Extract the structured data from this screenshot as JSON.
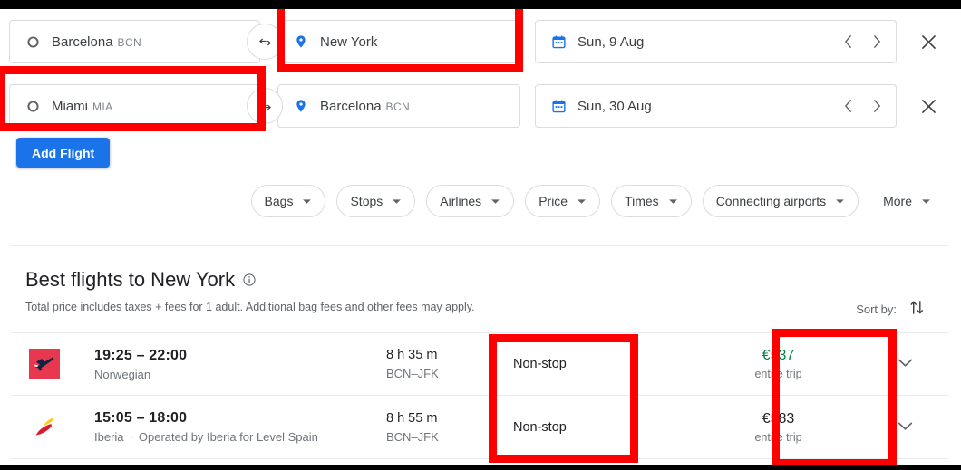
{
  "search": {
    "flights": [
      {
        "origin": {
          "city": "Barcelona",
          "code": "BCN",
          "icon": "circle-outline-icon"
        },
        "destination": {
          "city": "New York",
          "code": "",
          "icon": "location-pin-icon"
        },
        "date": "Sun, 9 Aug",
        "swap_icon": "swap-horizontal-icon",
        "calendar_icon": "calendar-icon",
        "prev_icon": "chevron-left-icon",
        "next_icon": "chevron-right-icon",
        "close_icon": "close-icon"
      },
      {
        "origin": {
          "city": "Miami",
          "code": "MIA",
          "icon": "circle-outline-icon"
        },
        "destination": {
          "city": "Barcelona",
          "code": "BCN",
          "icon": "location-pin-icon"
        },
        "date": "Sun, 30 Aug",
        "swap_icon": "swap-horizontal-icon",
        "calendar_icon": "calendar-icon",
        "prev_icon": "chevron-left-icon",
        "next_icon": "chevron-right-icon",
        "close_icon": "close-icon"
      }
    ],
    "add_flight_label": "Add Flight",
    "add_flight_color": "#1a73e8"
  },
  "filters": [
    {
      "label": "Bags",
      "caret": "chevron-down-icon"
    },
    {
      "label": "Stops",
      "caret": "chevron-down-icon"
    },
    {
      "label": "Airlines",
      "caret": "chevron-down-icon"
    },
    {
      "label": "Price",
      "caret": "chevron-down-icon"
    },
    {
      "label": "Times",
      "caret": "chevron-down-icon"
    },
    {
      "label": "Connecting airports",
      "caret": "chevron-down-icon"
    },
    {
      "label": "More",
      "caret": "chevron-down-icon"
    }
  ],
  "results": {
    "title": "Best flights to New York",
    "info_icon": "info-icon",
    "subtitle_before": "Total price includes taxes + fees for 1 adult. ",
    "subtitle_link": "Additional bag fees",
    "subtitle_after": " and other fees may apply.",
    "sort_label": "Sort by:",
    "sort_icon": "sort-arrows-icon",
    "flights": [
      {
        "airline_logo": "norwegian-logo",
        "times": "19:25 – 22:00",
        "airline": "Norwegian",
        "operator": "",
        "duration": "8 h 35 m",
        "route": "BCN–JFK",
        "stops": "Non-stop",
        "price": "€537",
        "price_note": "entire trip",
        "price_style": "cheap",
        "price_color": "#018642",
        "expand_icon": "chevron-down-icon"
      },
      {
        "airline_logo": "iberia-logo",
        "times": "15:05 – 18:00",
        "airline": "Iberia",
        "operator": "Operated by Iberia for Level Spain",
        "duration": "8 h 55 m",
        "route": "BCN–JFK",
        "stops": "Non-stop",
        "price": "€583",
        "price_note": "entire trip",
        "price_style": "normal",
        "price_color": "#202124",
        "expand_icon": "chevron-down-icon"
      }
    ]
  },
  "annotations": {
    "color": "#ff0000",
    "boxes": [
      {
        "name": "destination-field-highlight"
      },
      {
        "name": "origin-field-highlight"
      },
      {
        "name": "stops-column-highlight"
      },
      {
        "name": "price-column-highlight"
      }
    ]
  }
}
